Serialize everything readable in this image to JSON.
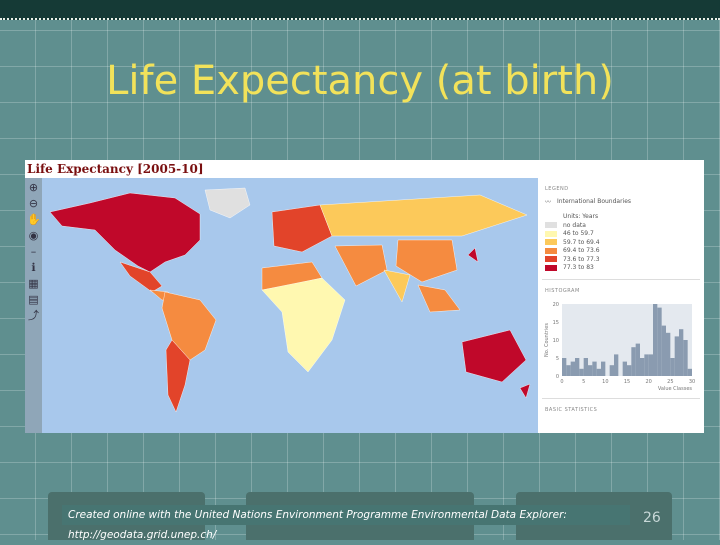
{
  "slide": {
    "title": "Life Expectancy (at birth)",
    "caption": "Created online with the United Nations Environment Programme Environmental Data Explorer: http://geodata.grid.unep.ch/",
    "page_number": "26"
  },
  "map": {
    "title": "Life Expectancy [2005-10]",
    "toolbar_icons": [
      "zoom-in-icon",
      "zoom-out-icon",
      "pan-hand-icon",
      "globe-icon",
      "info-icon",
      "chart-icon",
      "print-icon",
      "export-icon"
    ]
  },
  "legend": {
    "heading": "LEGEND",
    "boundaries_label": "International Boundaries",
    "units": "Units: Years",
    "classes": [
      {
        "label": "no data",
        "color": "#e0e0e0"
      },
      {
        "label": "46 to 59.7",
        "color": "#fff8b0"
      },
      {
        "label": "59.7 to 69.4",
        "color": "#fcc95a"
      },
      {
        "label": "69.4 to 73.6",
        "color": "#f58b40"
      },
      {
        "label": "73.6 to 77.3",
        "color": "#e2442a"
      },
      {
        "label": "77.3 to 83",
        "color": "#c0082a"
      }
    ]
  },
  "chart_data": {
    "type": "bar",
    "title": "HISTOGRAM",
    "ylabel": "No. Countries",
    "xlabel": "Value Classes",
    "xticks": [
      "0",
      "5",
      "10",
      "15",
      "20",
      "25",
      "30"
    ],
    "yticks": [
      "0",
      "5",
      "10",
      "15",
      "20"
    ],
    "ylim": [
      0,
      20
    ],
    "values": [
      5,
      3,
      4,
      5,
      2,
      5,
      3,
      4,
      2,
      4,
      0,
      3,
      6,
      0,
      4,
      3,
      8,
      9,
      5,
      6,
      6,
      20,
      19,
      14,
      12,
      5,
      11,
      13,
      10,
      2
    ],
    "color": "#8a9bb0"
  },
  "statistics": {
    "heading": "BASIC STATISTICS"
  }
}
